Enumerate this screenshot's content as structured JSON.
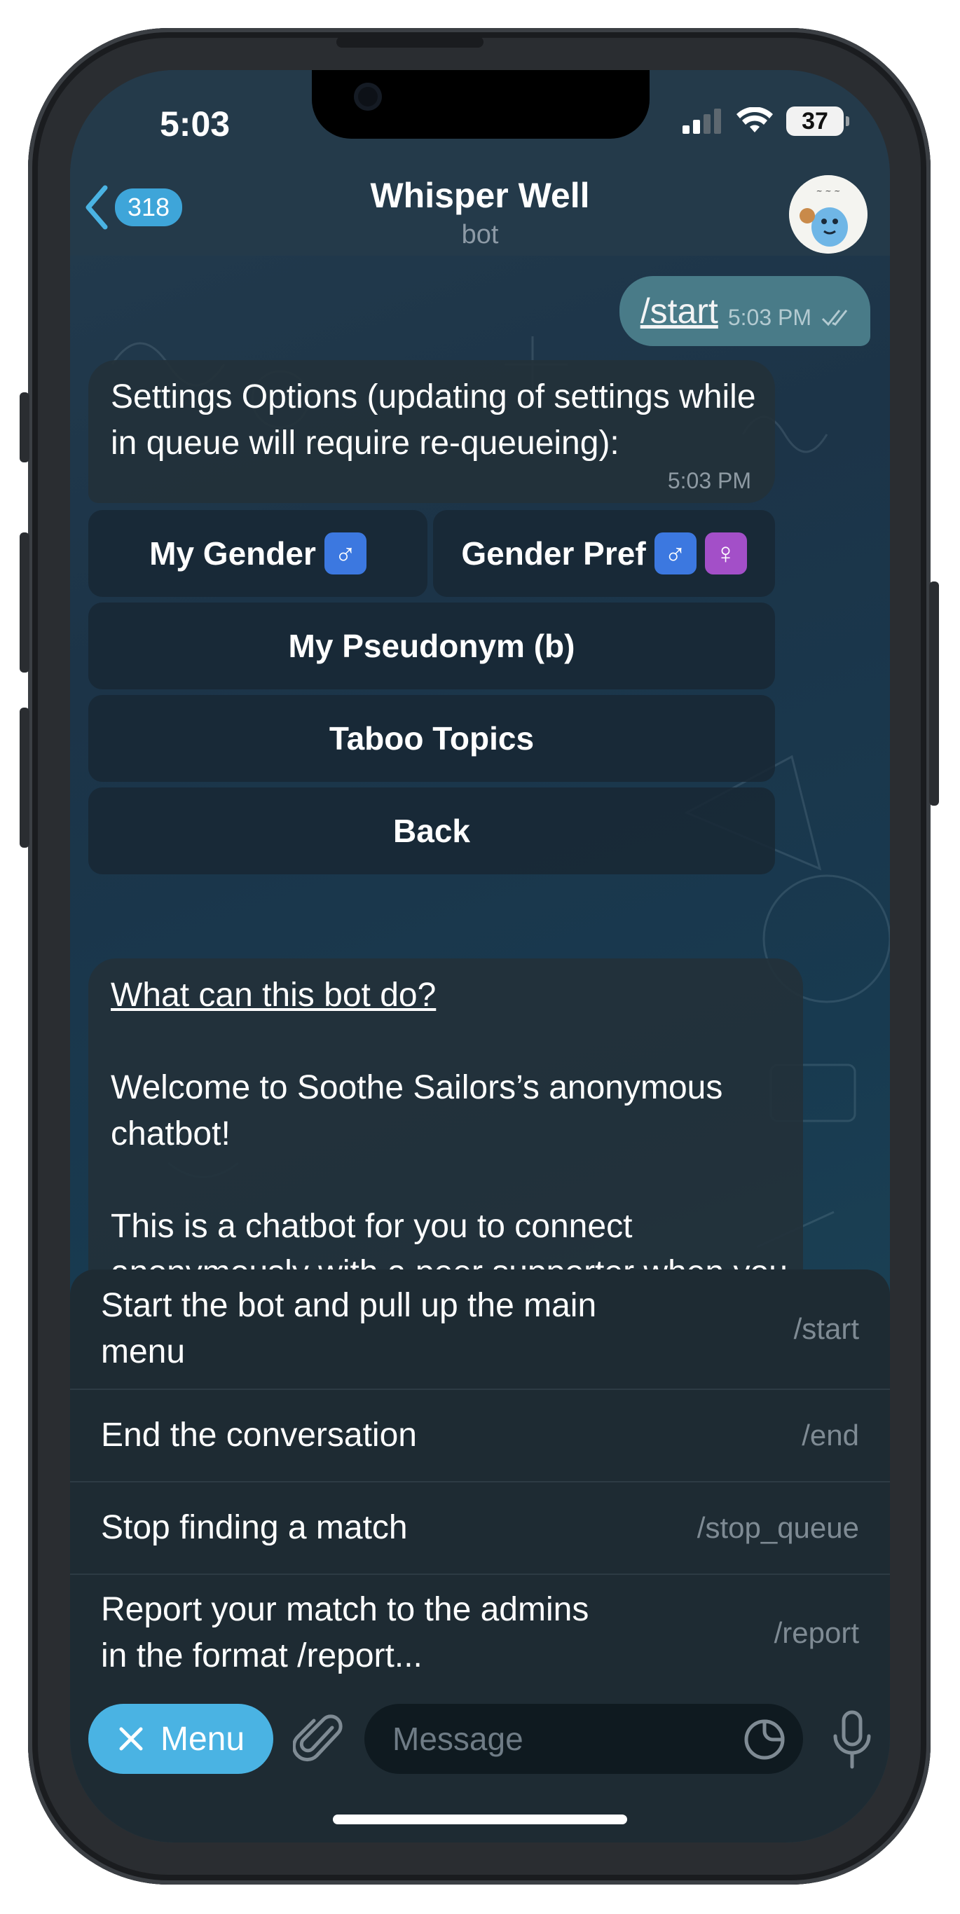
{
  "status_bar": {
    "time": "5:03",
    "battery": "37",
    "signal_icon": "cellular-signal-icon",
    "wifi_icon": "wifi-icon"
  },
  "header": {
    "back_count": "318",
    "title": "Whisper Well",
    "subtitle": "bot",
    "avatar_icon": "bot-avatar-icon"
  },
  "outgoing_message": {
    "text": "/start",
    "time": "5:03 PM"
  },
  "settings_message": {
    "text": "Settings Options (updating of settings while in queue will require re-queueing):",
    "time": "5:03 PM"
  },
  "keyboard": {
    "my_gender": "My Gender",
    "gender_pref": "Gender Pref",
    "my_pseudonym": "My Pseudonym (b)",
    "taboo_topics": "Taboo Topics",
    "back": "Back"
  },
  "bot_description": {
    "title": "What can this bot do?",
    "body": "Welcome to Soothe Sailors’s anonymous chatbot!\n\nThis is a chatbot for you to connect anonymously with a peer supporter when you need a listening ear! We are a safe"
  },
  "commands": [
    {
      "description": "Start the bot and pull up the main menu",
      "command": "/start"
    },
    {
      "description": "End the conversation",
      "command": "/end"
    },
    {
      "description": "Stop finding a match",
      "command": "/stop_queue"
    },
    {
      "description": "Report your match to the admins in the format /report...",
      "command": "/report"
    }
  ],
  "bottom_bar": {
    "menu_label": "Menu",
    "message_placeholder": "Message"
  },
  "colors": {
    "accent": "#4ab3e3",
    "badge": "#3ea5d9",
    "panel": "#1e2b33"
  }
}
